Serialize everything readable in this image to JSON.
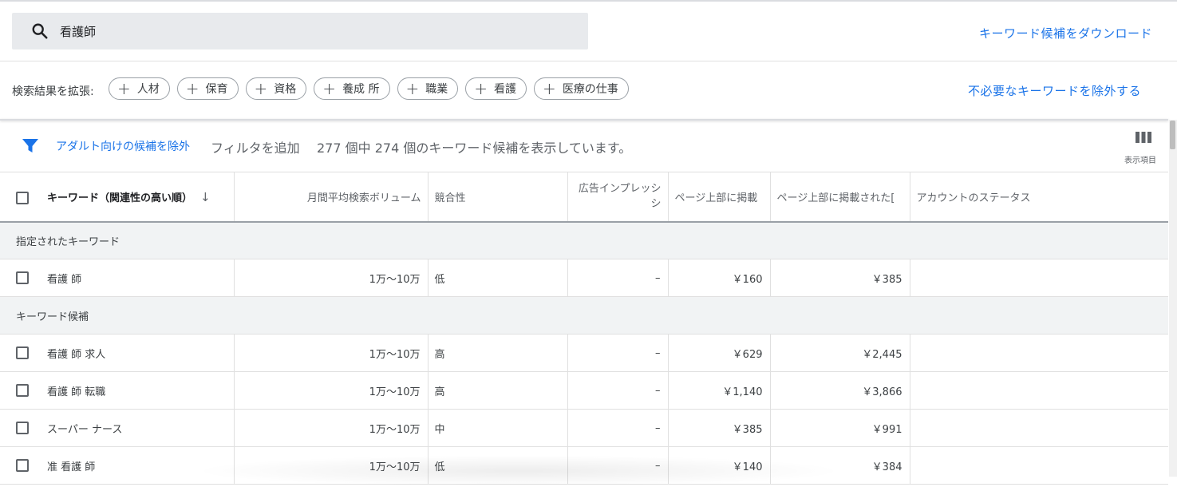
{
  "search": {
    "value": "看護師"
  },
  "download_link": "キーワード候補をダウンロード",
  "expand": {
    "label": "検索結果を拡張:",
    "chips": [
      "人材",
      "保育",
      "資格",
      "養成 所",
      "職業",
      "看護",
      "医療の仕事"
    ]
  },
  "exclude_link": "不必要なキーワードを除外する",
  "filter_bar": {
    "adult_link": "アダルト向けの候補を除外",
    "add_filter": "フィルタを追加",
    "result_text": "277 個中 274 個のキーワード候補を表示しています。",
    "columns_label": "表示項目"
  },
  "table": {
    "headers": {
      "keyword": "キーワード（関連性の高い順）",
      "volume": "月間平均検索ボリューム",
      "competition": "競合性",
      "impressions": "広告インプレッシ シ",
      "top_bid_low": "ページ上部に掲載",
      "top_bid_high": "ページ上部に掲載された[",
      "account_status": "アカウントのステータス"
    },
    "groups": [
      {
        "label": "指定されたキーワード",
        "rows": [
          {
            "keyword": "看護 師",
            "volume": "1万～10万",
            "competition": "低",
            "impressions": "–",
            "low": "￥160",
            "high": "￥385",
            "status": ""
          }
        ]
      },
      {
        "label": "キーワード候補",
        "rows": [
          {
            "keyword": "看護 師 求人",
            "volume": "1万～10万",
            "competition": "高",
            "impressions": "–",
            "low": "￥629",
            "high": "￥2,445",
            "status": ""
          },
          {
            "keyword": "看護 師 転職",
            "volume": "1万～10万",
            "competition": "高",
            "impressions": "–",
            "low": "￥1,140",
            "high": "￥3,866",
            "status": ""
          },
          {
            "keyword": "スーパー ナース",
            "volume": "1万～10万",
            "competition": "中",
            "impressions": "–",
            "low": "￥385",
            "high": "￥991",
            "status": ""
          },
          {
            "keyword": "准 看護 師",
            "volume": "1万～10万",
            "competition": "低",
            "impressions": "–",
            "low": "￥140",
            "high": "￥384",
            "status": ""
          }
        ]
      }
    ]
  },
  "colors": {
    "accent": "#1a73e8",
    "group_bg": "#f1f3f4",
    "search_bg": "#e8eaed"
  }
}
